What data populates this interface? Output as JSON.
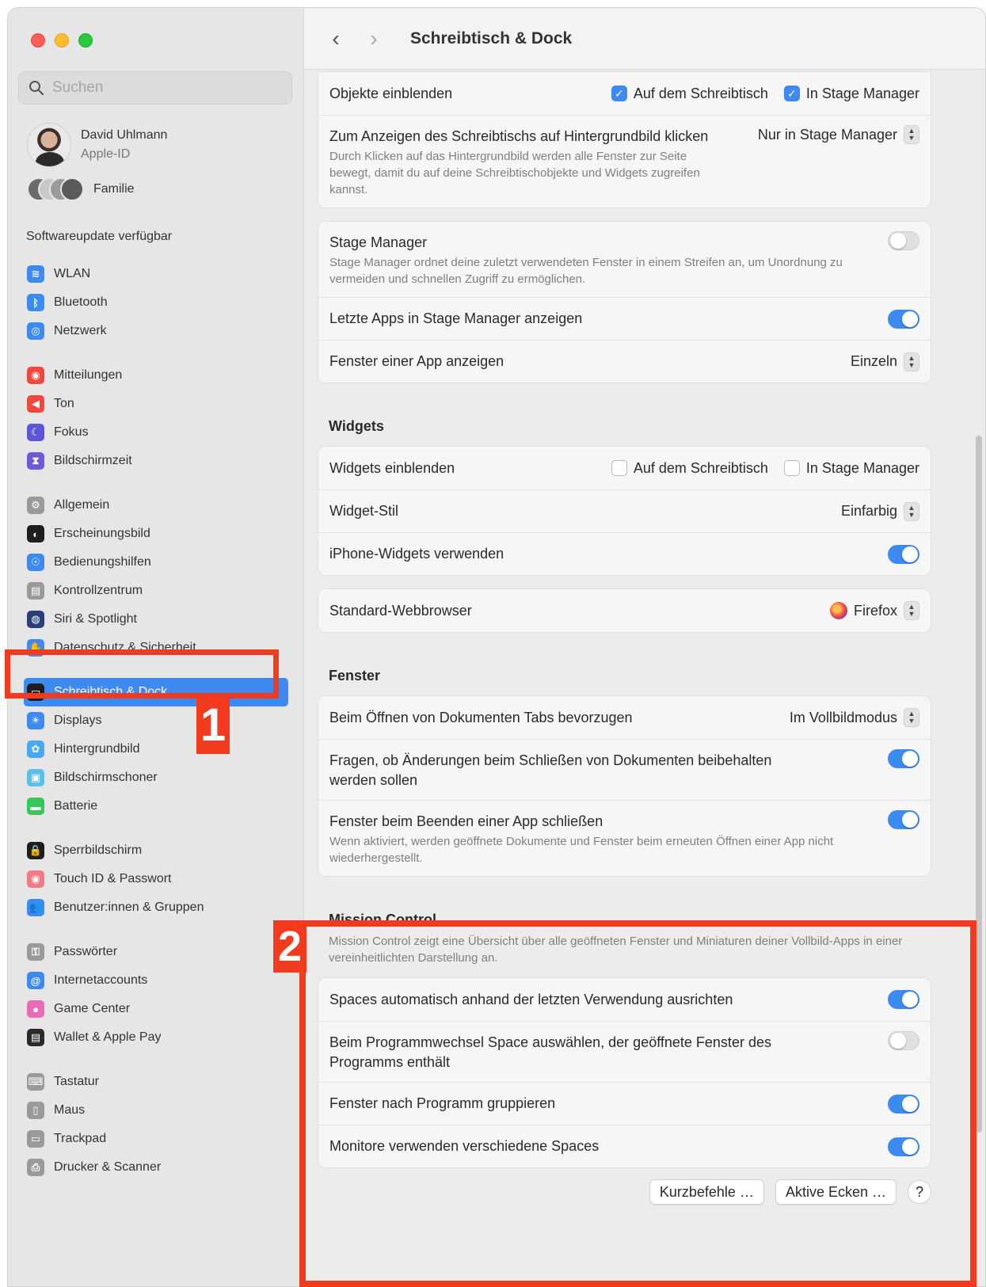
{
  "sidebar": {
    "search_placeholder": "Suchen",
    "profile": {
      "name": "David Uhlmann",
      "sub": "Apple-ID"
    },
    "family": "Familie",
    "software_update": "Softwareupdate verfügbar",
    "groups": [
      [
        {
          "label": "WLAN",
          "icon": "wifi-icon",
          "color": "#3d8af0",
          "glyph": "≋"
        },
        {
          "label": "Bluetooth",
          "icon": "bluetooth-icon",
          "color": "#3d8af0",
          "glyph": "ᛒ"
        },
        {
          "label": "Netzwerk",
          "icon": "globe-icon",
          "color": "#3d8af0",
          "glyph": "◎"
        }
      ],
      [
        {
          "label": "Mitteilungen",
          "icon": "bell-icon",
          "color": "#f0473e",
          "glyph": "◉"
        },
        {
          "label": "Ton",
          "icon": "speaker-icon",
          "color": "#f0473e",
          "glyph": "◀"
        },
        {
          "label": "Fokus",
          "icon": "moon-icon",
          "color": "#5b56d6",
          "glyph": "☾"
        },
        {
          "label": "Bildschirmzeit",
          "icon": "hourglass-icon",
          "color": "#6b5bd6",
          "glyph": "⧗"
        }
      ],
      [
        {
          "label": "Allgemein",
          "icon": "gear-icon",
          "color": "#9a9a9a",
          "glyph": "⚙"
        },
        {
          "label": "Erscheinungsbild",
          "icon": "appearance-icon",
          "color": "#1e1e1e",
          "glyph": "◐"
        },
        {
          "label": "Bedienungshilfen",
          "icon": "accessibility-icon",
          "color": "#3d8af0",
          "glyph": "☉"
        },
        {
          "label": "Kontrollzentrum",
          "icon": "control-center-icon",
          "color": "#9a9a9a",
          "glyph": "▤"
        },
        {
          "label": "Siri & Spotlight",
          "icon": "siri-icon",
          "color": "#2a3f7a",
          "glyph": "◍"
        },
        {
          "label": "Datenschutz & Sicherheit",
          "icon": "hand-icon",
          "color": "#3d8af0",
          "glyph": "✋"
        }
      ],
      [
        {
          "label": "Schreibtisch & Dock",
          "icon": "dock-icon",
          "color": "#1e1e1e",
          "glyph": "▭",
          "active": true
        },
        {
          "label": "Displays",
          "icon": "display-icon",
          "color": "#3d8af0",
          "glyph": "☀"
        },
        {
          "label": "Hintergrundbild",
          "icon": "wallpaper-icon",
          "color": "#4aa8f0",
          "glyph": "✿"
        },
        {
          "label": "Bildschirmschoner",
          "icon": "screensaver-icon",
          "color": "#5bbfe8",
          "glyph": "▣"
        },
        {
          "label": "Batterie",
          "icon": "battery-icon",
          "color": "#34c759",
          "glyph": "▬"
        }
      ],
      [
        {
          "label": "Sperrbildschirm",
          "icon": "lock-icon",
          "color": "#1e1e1e",
          "glyph": "🔒"
        },
        {
          "label": "Touch ID & Passwort",
          "icon": "fingerprint-icon",
          "color": "#f07a8a",
          "glyph": "◉"
        },
        {
          "label": "Benutzer:innen & Gruppen",
          "icon": "users-icon",
          "color": "#3d8af0",
          "glyph": "👥"
        }
      ],
      [
        {
          "label": "Passwörter",
          "icon": "key-icon",
          "color": "#9a9a9a",
          "glyph": "⚿"
        },
        {
          "label": "Internetaccounts",
          "icon": "at-icon",
          "color": "#3d8af0",
          "glyph": "@"
        },
        {
          "label": "Game Center",
          "icon": "game-center-icon",
          "color": "#e86ab8",
          "glyph": "●"
        },
        {
          "label": "Wallet & Apple Pay",
          "icon": "wallet-icon",
          "color": "#2a2a2a",
          "glyph": "▤"
        }
      ],
      [
        {
          "label": "Tastatur",
          "icon": "keyboard-icon",
          "color": "#9a9a9a",
          "glyph": "⌨"
        },
        {
          "label": "Maus",
          "icon": "mouse-icon",
          "color": "#9a9a9a",
          "glyph": "▯"
        },
        {
          "label": "Trackpad",
          "icon": "trackpad-icon",
          "color": "#9a9a9a",
          "glyph": "▭"
        },
        {
          "label": "Drucker & Scanner",
          "icon": "printer-icon",
          "color": "#9a9a9a",
          "glyph": "⎙"
        }
      ]
    ]
  },
  "badges": {
    "one": "1",
    "two": "2"
  },
  "toolbar": {
    "back": "‹",
    "forward": "›",
    "title": "Schreibtisch & Dock"
  },
  "settings": {
    "objekte": {
      "label": "Objekte einblenden",
      "opt1": "Auf dem Schreibtisch",
      "opt1_checked": true,
      "opt2": "In Stage Manager",
      "opt2_checked": true
    },
    "klicken": {
      "label": "Zum Anzeigen des Schreibtischs auf Hintergrundbild klicken",
      "desc": "Durch Klicken auf das Hintergrundbild werden alle Fenster zur Seite bewegt, damit du auf deine Schreibtischobjekte und Widgets zugreifen kannst.",
      "value": "Nur in Stage Manager"
    },
    "stage_manager": {
      "label": "Stage Manager",
      "desc": "Stage Manager ordnet deine zuletzt verwendeten Fenster in einem Streifen an, um Unordnung zu vermeiden und schnellen Zugriff zu ermöglichen.",
      "on": false
    },
    "letzte_apps": {
      "label": "Letzte Apps in Stage Manager anzeigen",
      "on": true
    },
    "fenster_app": {
      "label": "Fenster einer App anzeigen",
      "value": "Einzeln"
    },
    "widgets_title": "Widgets",
    "widgets_einblenden": {
      "label": "Widgets einblenden",
      "opt1": "Auf dem Schreibtisch",
      "opt1_checked": false,
      "opt2": "In Stage Manager",
      "opt2_checked": false
    },
    "widget_stil": {
      "label": "Widget-Stil",
      "value": "Einfarbig"
    },
    "iphone_widgets": {
      "label": "iPhone-Widgets verwenden",
      "on": true
    },
    "webbrowser": {
      "label": "Standard-Webbrowser",
      "value": "Firefox"
    },
    "fenster_title": "Fenster",
    "tabs": {
      "label": "Beim Öffnen von Dokumenten Tabs bevorzugen",
      "value": "Im Vollbildmodus"
    },
    "fragen": {
      "label": "Fragen, ob Änderungen beim Schließen von Dokumenten beibehalten werden sollen",
      "on": true
    },
    "schliessen": {
      "label": "Fenster beim Beenden einer App schließen",
      "desc": "Wenn aktiviert, werden geöffnete Dokumente und Fenster beim erneuten Öffnen einer App nicht wiederhergestellt.",
      "on": true
    },
    "mission_title": "Mission Control",
    "mission_desc": "Mission Control zeigt eine Übersicht über alle geöffneten Fenster und Miniaturen deiner Vollbild-Apps in einer vereinheitlichten Darstellung an.",
    "spaces_auto": {
      "label": "Spaces automatisch anhand der letzten Verwendung ausrichten",
      "on": true
    },
    "programmwechsel": {
      "label": "Beim Programmwechsel Space auswählen, der geöffnete Fenster des Programms enthält",
      "on": false
    },
    "gruppieren": {
      "label": "Fenster nach Programm gruppieren",
      "on": true
    },
    "monitore": {
      "label": "Monitore verwenden verschiedene Spaces",
      "on": true
    },
    "buttons": {
      "shortcuts": "Kurzbefehle …",
      "hot_corners": "Aktive Ecken …",
      "help": "?"
    }
  }
}
